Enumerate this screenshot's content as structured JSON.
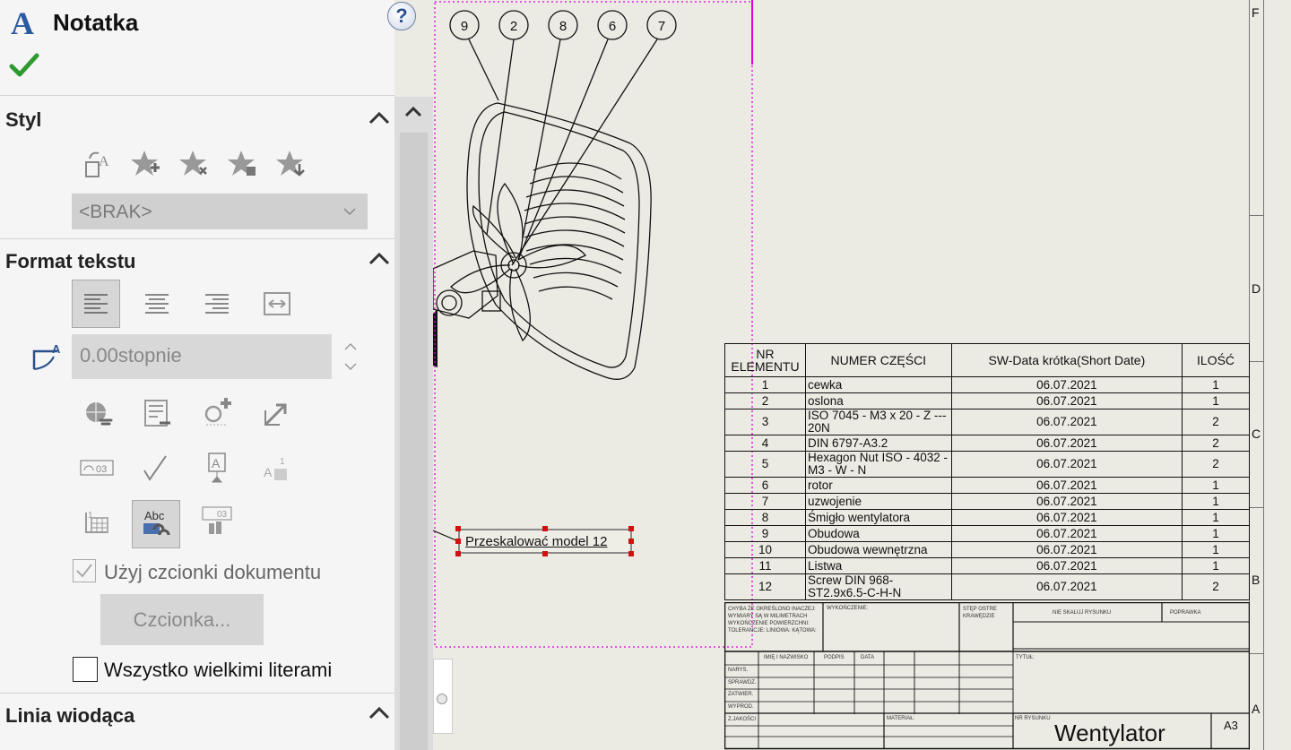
{
  "panel": {
    "title": "Notatka",
    "help_icon": "question-mark-icon",
    "sections": {
      "style": {
        "title": "Styl",
        "dropdown_value": "<BRAK>"
      },
      "text_format": {
        "title": "Format tekstu",
        "angle_value": "0.00stopnie",
        "use_doc_font_label": "Użyj czcionki dokumentu",
        "font_button_label": "Czcionka...",
        "all_caps_label": "Wszystko wielkimi literami",
        "use_doc_font_checked": true,
        "all_caps_checked": false
      },
      "leader": {
        "title": "Linia wiodąca"
      }
    }
  },
  "drawing": {
    "balloons": [
      "9",
      "2",
      "8",
      "6",
      "7"
    ],
    "note_text": "Przeskalować model 12",
    "zone_labels": {
      "f": "F",
      "d": "D",
      "c": "C",
      "b": "B",
      "a": "A"
    },
    "bom": {
      "headers": [
        "NR ELEMENTU",
        "NUMER CZĘŚCI",
        "SW-Data krótka(Short Date)",
        "ILOŚĆ"
      ],
      "rows": [
        [
          "1",
          "cewka",
          "06.07.2021",
          "1"
        ],
        [
          "2",
          "oslona",
          "06.07.2021",
          "1"
        ],
        [
          "3",
          "ISO 7045 - M3 x 20 - Z --- 20N",
          "06.07.2021",
          "2"
        ],
        [
          "4",
          "DIN 6797-A3.2",
          "06.07.2021",
          "2"
        ],
        [
          "5",
          "Hexagon Nut ISO - 4032 - M3 - W - N",
          "06.07.2021",
          "2"
        ],
        [
          "6",
          "rotor",
          "06.07.2021",
          "1"
        ],
        [
          "7",
          "uzwojenie",
          "06.07.2021",
          "1"
        ],
        [
          "8",
          "Śmigło wentylatora",
          "06.07.2021",
          "1"
        ],
        [
          "9",
          "Obudowa",
          "06.07.2021",
          "1"
        ],
        [
          "10",
          "Obudowa wewnętrzna",
          "06.07.2021",
          "1"
        ],
        [
          "11",
          "Listwa",
          "06.07.2021",
          "1"
        ],
        [
          "12",
          "Screw DIN 968-ST2.9x6.5-C-H-N",
          "06.07.2021",
          "2"
        ]
      ]
    },
    "title_block": {
      "general_tol": "CHYBA ŻE OKREŚLONO INACZEJ: WYMIARY SĄ W MILIMETRACH WYKOŃCZENIE POWIERZCHNI: TOLERANCJE: LINIOWA: KĄTOWA:",
      "finish": "WYKOŃCZENIE:",
      "edges": "STĘP OSTRE KRAWĘDZIE",
      "noscale": "NIE SKALUJ RYSUNKU",
      "revision": "POPRAWKA",
      "title_label": "TYTUŁ:",
      "name_col": "IMIĘ I NAZWISKO",
      "sign_col": "PODPIS",
      "date_col": "DATA",
      "rows": [
        "NARYS.",
        "SPRAWDZ.",
        "ZATWIER.",
        "WYPROD.",
        "Z.JAKOŚCI"
      ],
      "material": "MATERIAŁ:",
      "drawing_no_label": "NR RYSUNKU",
      "drawing_title": "Wentylator",
      "sheet_size": "A3"
    }
  },
  "colors": {
    "accent_check": "#2e9a2e",
    "selection": "#e000e0",
    "grip": "#d11010"
  }
}
